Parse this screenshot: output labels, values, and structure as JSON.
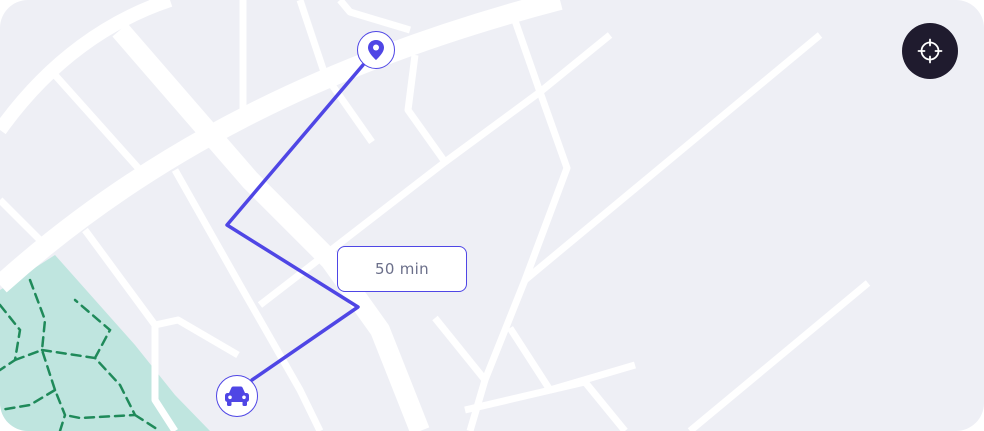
{
  "map": {
    "route": {
      "eta_label": "50 min",
      "color": "#4f46e5"
    },
    "colors": {
      "background": "#eeeff5",
      "road": "#ffffff",
      "park": "#bfe5df",
      "park_trail": "#1f8a5a",
      "locate_button": "#1f1b2e"
    },
    "markers": {
      "destination_icon": "location-pin-icon",
      "vehicle_icon": "car-icon"
    },
    "controls": {
      "locate_icon": "crosshair-icon"
    }
  }
}
